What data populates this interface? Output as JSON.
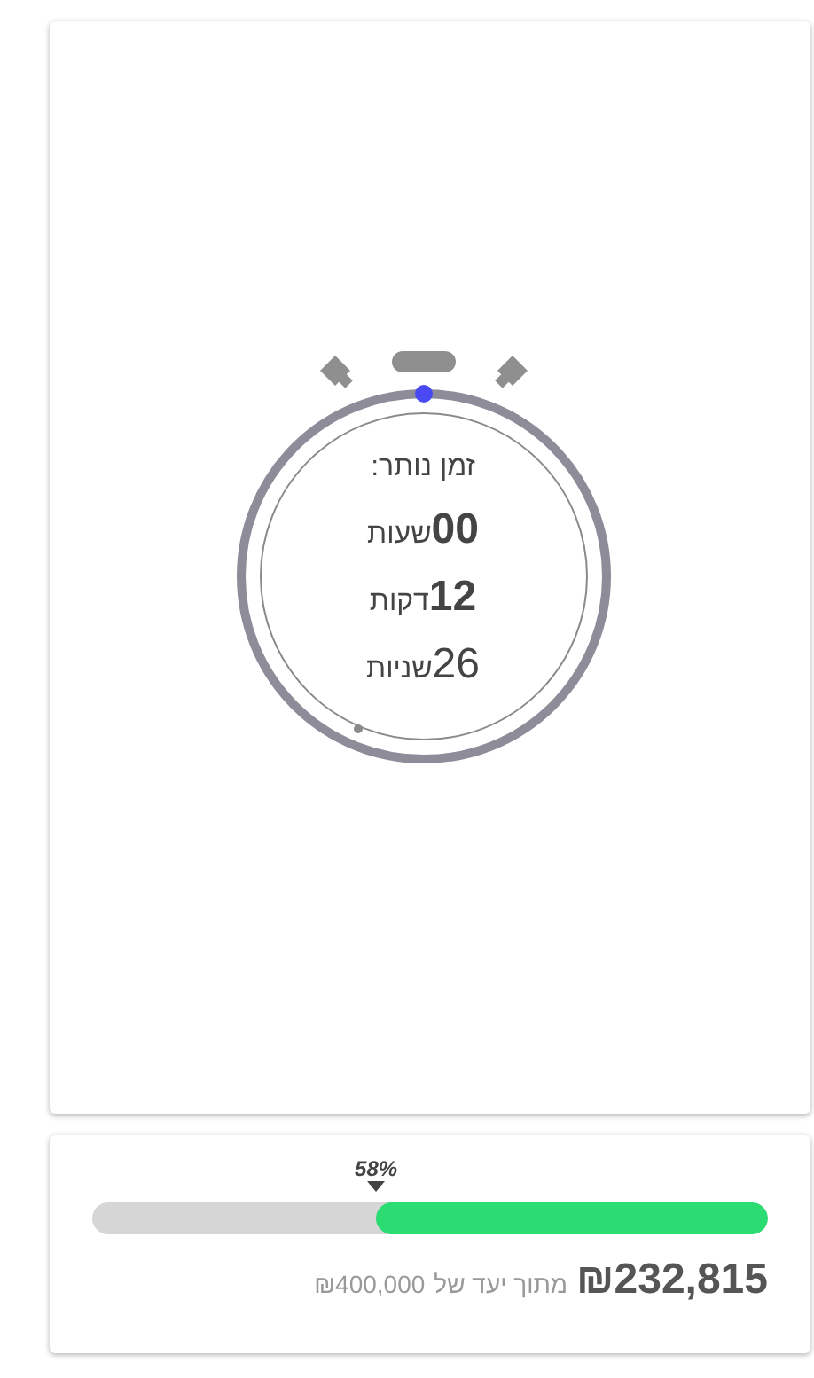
{
  "timer": {
    "title": "זמן נותר:",
    "units": [
      {
        "value": "00",
        "unit": "שעות",
        "bold": true
      },
      {
        "value": "12",
        "unit": "דקות",
        "bold": true
      },
      {
        "value": "26",
        "unit": "שניות",
        "bold": false
      }
    ]
  },
  "goal": {
    "percent": "58%",
    "level": 0.58,
    "raised": "₪232,815",
    "target_text": "מתוך יעד של",
    "target": "₪400,000"
  }
}
